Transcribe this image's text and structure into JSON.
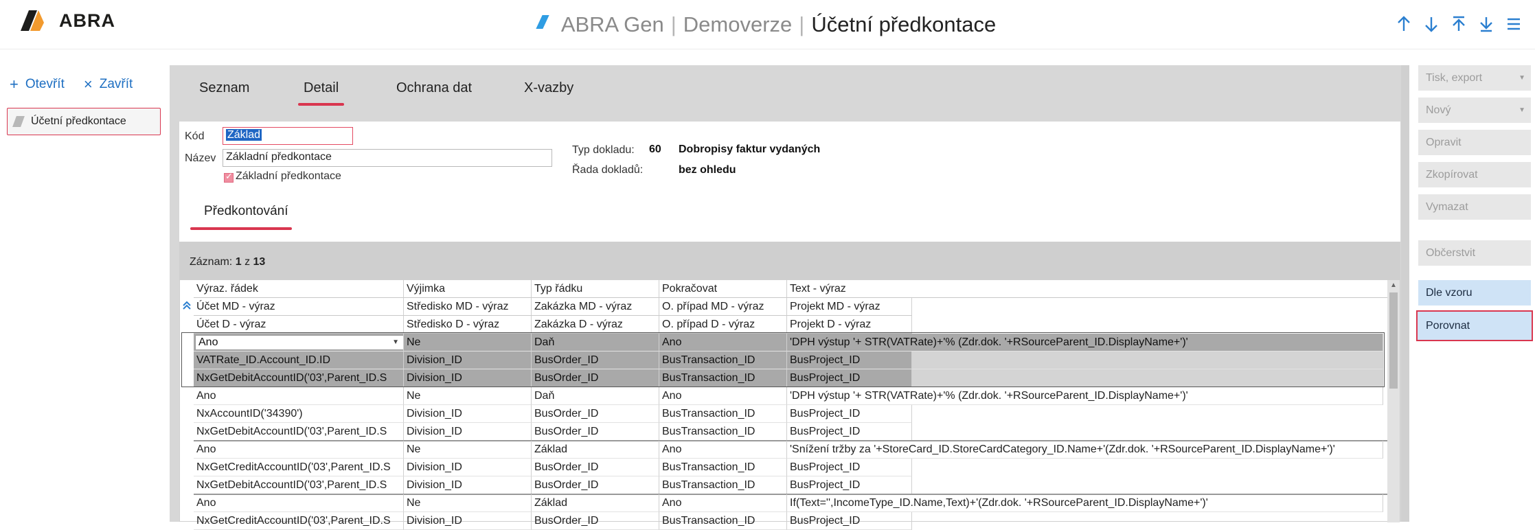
{
  "header": {
    "logo_text": "ABRA",
    "app_name": "ABRA Gen",
    "edition": "Demoverze",
    "page_title": "Účetní předkontace",
    "separator": "|",
    "nav_icons": [
      "arrow-up-icon",
      "arrow-down-icon",
      "arrow-top-icon",
      "arrow-bottom-icon",
      "menu-icon"
    ]
  },
  "left": {
    "open_label": "Otevřít",
    "close_label": "Zavřít",
    "open_tab_label": "Účetní předkontace"
  },
  "tabs": [
    {
      "label": "Seznam",
      "active": false
    },
    {
      "label": "Detail",
      "active": true
    },
    {
      "label": "Ochrana dat",
      "active": false
    },
    {
      "label": "X-vazby",
      "active": false
    }
  ],
  "form": {
    "code_label": "Kód",
    "code_value": "Základ",
    "name_label": "Název",
    "name_value": "Základní předkontace",
    "basic_checkbox_label": "Základní předkontace",
    "basic_checked": true,
    "doc_type_label": "Typ dokladu:",
    "doc_type_code": "60",
    "doc_type_name": "Dobropisy faktur vydaných",
    "doc_series_label": "Řada dokladů:",
    "doc_series_value": "bez ohledu"
  },
  "subtab": "Předkontování",
  "grid": {
    "record_label": "Záznam:",
    "record_current": "1",
    "record_of": "z",
    "record_total": "13",
    "header_rows": [
      [
        "Výraz. řádek",
        "Výjimka",
        "Typ řádku",
        "Pokračovat",
        "Text - výraz"
      ],
      [
        "Účet MD - výraz",
        "Středisko MD - výraz",
        "Zakázka MD - výraz",
        "O. případ MD - výraz",
        "Projekt MD - výraz"
      ],
      [
        "Účet D - výraz",
        "Středisko D - výraz",
        "Zakázka D - výraz",
        "O. případ D - výraz",
        "Projekt D - výraz"
      ]
    ],
    "rows": [
      [
        "Ano",
        "Ne",
        "Daň",
        "Ano",
        "'DPH výstup '+ STR(VATRate)+'% (Zdr.dok. '+RSourceParent_ID.DisplayName+')'"
      ],
      [
        "VATRate_ID.Account_ID.ID",
        "Division_ID",
        "BusOrder_ID",
        "BusTransaction_ID",
        "BusProject_ID"
      ],
      [
        "NxGetDebitAccountID('03',Parent_ID.S",
        "Division_ID",
        "BusOrder_ID",
        "BusTransaction_ID",
        "BusProject_ID"
      ],
      [
        "Ano",
        "Ne",
        "Daň",
        "Ano",
        "'DPH výstup '+ STR(VATRate)+'% (Zdr.dok. '+RSourceParent_ID.DisplayName+')'"
      ],
      [
        "NxAccountID('34390')",
        "Division_ID",
        "BusOrder_ID",
        "BusTransaction_ID",
        "BusProject_ID"
      ],
      [
        "NxGetDebitAccountID('03',Parent_ID.S",
        "Division_ID",
        "BusOrder_ID",
        "BusTransaction_ID",
        "BusProject_ID"
      ],
      [
        "Ano",
        "Ne",
        "Základ",
        "Ano",
        "'Snížení tržby za '+StoreCard_ID.StoreCardCategory_ID.Name+'(Zdr.dok. '+RSourceParent_ID.DisplayName+')'"
      ],
      [
        "NxGetCreditAccountID('03',Parent_ID.S",
        "Division_ID",
        "BusOrder_ID",
        "BusTransaction_ID",
        "BusProject_ID"
      ],
      [
        "NxGetDebitAccountID('03',Parent_ID.S",
        "Division_ID",
        "BusOrder_ID",
        "BusTransaction_ID",
        "BusProject_ID"
      ],
      [
        "Ano",
        "Ne",
        "Základ",
        "Ano",
        "If(Text='',IncomeType_ID.Name,Text)+'(Zdr.dok. '+RSourceParent_ID.DisplayName+')'"
      ],
      [
        "NxGetCreditAccountID('03',Parent_ID.S",
        "Division_ID",
        "BusOrder_ID",
        "BusTransaction_ID",
        "BusProject_ID"
      ]
    ]
  },
  "right_panel": {
    "print_export": "Tisk, export",
    "new": "Nový",
    "edit": "Opravit",
    "copy": "Zkopírovat",
    "delete": "Vymazat",
    "refresh": "Občerstvit",
    "by_template": "Dle vzoru",
    "compare": "Porovnat"
  },
  "colors": {
    "accent_red": "#d9364f",
    "link_blue": "#1e6fc2",
    "selection_blue": "#1f66c4",
    "active_button": "#cfe3f6"
  }
}
